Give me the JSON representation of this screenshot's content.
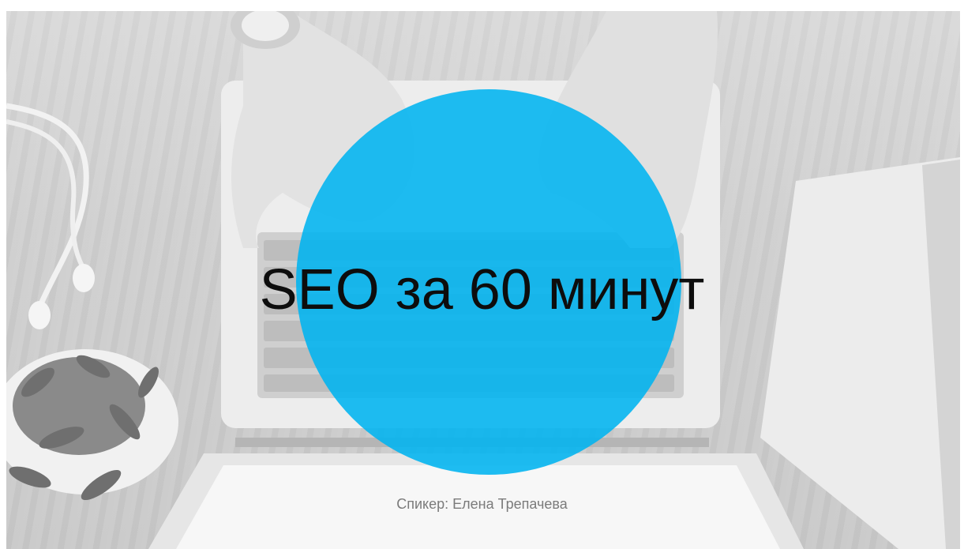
{
  "slide": {
    "title": "SEO за 60 минут",
    "speaker": "Спикер: Елена Трепачева"
  },
  "colors": {
    "circle": "#00B4F0",
    "title_text": "#0D0D0D",
    "speaker_text": "#7B7B7B"
  }
}
